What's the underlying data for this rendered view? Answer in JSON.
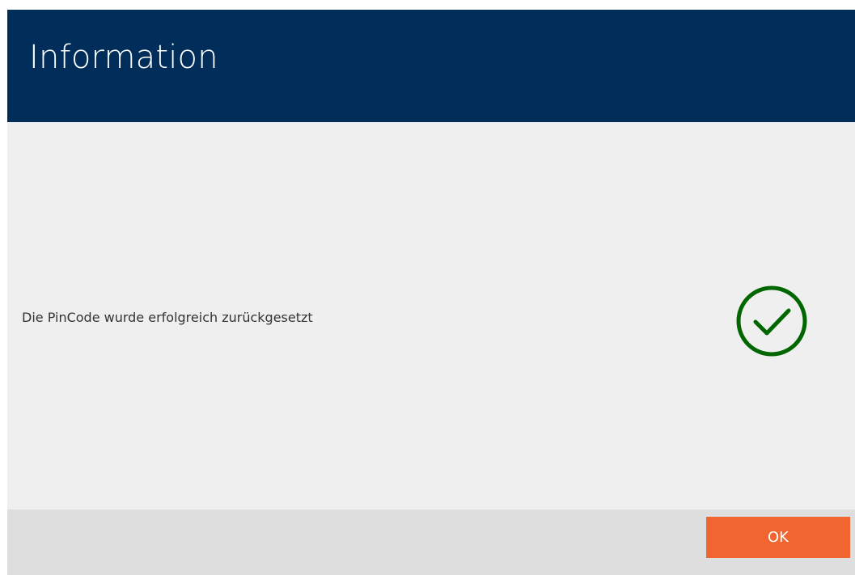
{
  "dialog": {
    "title": "Information",
    "message": "Die PinCode wurde erfolgreich zurückgesetzt",
    "status_icon": "check-circle-icon",
    "ok_label": "OK"
  },
  "colors": {
    "header_bg": "#002d59",
    "body_bg": "#efefef",
    "footer_bg": "#dedede",
    "accent": "#f06530",
    "success": "#006600"
  }
}
